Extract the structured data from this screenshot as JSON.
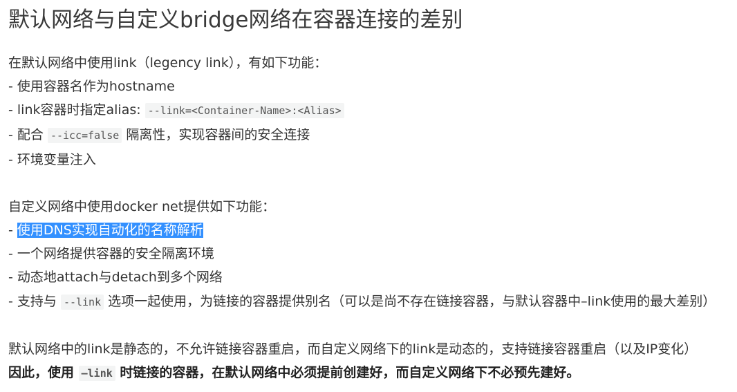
{
  "title": "默认网络与自定义bridge网络在容器连接的差别",
  "section1": {
    "intro": "在默认网络中使用link（legency link），有如下功能：",
    "items": [
      "- 使用容器名作为hostname",
      "- link容器时指定alias: ",
      "- 配合 ",
      "- 环境变量注入"
    ],
    "item2_code": "--link=<Container-Name>:<Alias>",
    "item3_code": "--icc=false",
    "item3_suffix": " 隔离性，实现容器间的安全连接"
  },
  "section2": {
    "intro": "自定义网络中使用docker net提供如下功能：",
    "item1_prefix": "- ",
    "item1_highlight": "使用DNS实现自动化的名称解析",
    "items": [
      "- 一个网络提供容器的安全隔离环境",
      "- 动态地attach与detach到多个网络"
    ],
    "item4_prefix": "- 支持与 ",
    "item4_code": "--link",
    "item4_suffix": " 选项一起使用，为链接的容器提供别名（可以是尚不存在链接容器，与默认容器中–link使用的最大差别）"
  },
  "section3": {
    "line1": "默认网络中的link是静态的，不允许链接容器重启，而自定义网络下的link是动态的，支持链接容器重启（以及IP变化）",
    "line2_prefix": "因此，使用 ",
    "line2_code": "—link",
    "line2_suffix": " 时链接的容器，在默认网络中必须提前创建好，而自定义网络下不必预先建好。"
  },
  "colors": {
    "highlight": "#3390ff",
    "text": "#333333",
    "code_bg": "#f3f4f4"
  }
}
